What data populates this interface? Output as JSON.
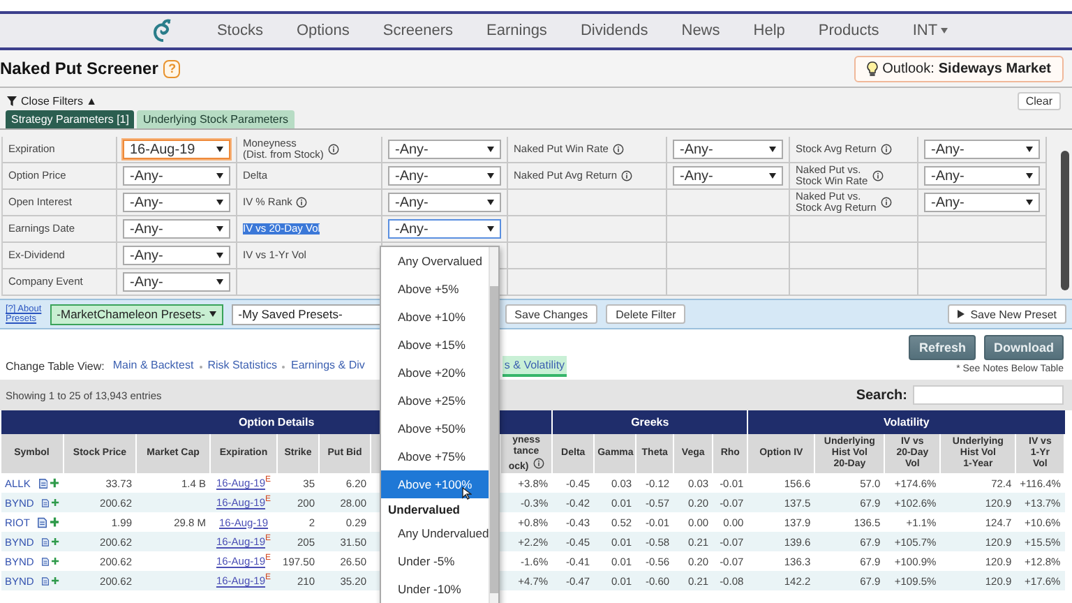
{
  "nav": {
    "items": [
      {
        "label": "Stocks",
        "kind": "link"
      },
      {
        "label": "Options",
        "kind": "link"
      },
      {
        "label": "Screeners",
        "kind": "link"
      },
      {
        "label": "Earnings",
        "kind": "link"
      },
      {
        "label": "Dividends",
        "kind": "link"
      },
      {
        "label": "News",
        "kind": "link"
      },
      {
        "label": "Help",
        "kind": "link"
      },
      {
        "label": "Products",
        "kind": "link"
      },
      {
        "label": "INT",
        "kind": "menu"
      }
    ]
  },
  "title": "Naked Put Screener",
  "help_badge": "?",
  "outlook": {
    "label": "Outlook:",
    "value": "Sideways Market"
  },
  "filters": {
    "toggle": "Close Filters ▲",
    "clear": "Clear",
    "tabs": [
      {
        "label": "Strategy Parameters [1]",
        "selected": true
      },
      {
        "label": "Underlying Stock Parameters",
        "selected": false
      }
    ],
    "rows": [
      {
        "cells": [
          {
            "kind": "label",
            "text": "Expiration",
            "info": false,
            "highlighted": false
          },
          {
            "kind": "select",
            "value": "16-Aug-19",
            "active": true,
            "focused": false
          },
          {
            "kind": "label",
            "text": "Moneyness\n(Dist. from Stock)",
            "info": true,
            "highlighted": false
          },
          {
            "kind": "select",
            "value": "-Any-",
            "active": false,
            "focused": false
          },
          {
            "kind": "label",
            "text": "Naked Put Win Rate",
            "info": true,
            "highlighted": false
          },
          {
            "kind": "select",
            "value": "-Any-",
            "active": false,
            "focused": false
          },
          {
            "kind": "label",
            "text": "Stock Avg Return",
            "info": true,
            "highlighted": false
          },
          {
            "kind": "select",
            "value": "-Any-",
            "active": false,
            "focused": false
          }
        ]
      },
      {
        "cells": [
          {
            "kind": "label",
            "text": "Option Price",
            "info": false,
            "highlighted": false
          },
          {
            "kind": "select",
            "value": "-Any-",
            "active": false,
            "focused": false
          },
          {
            "kind": "label",
            "text": "Delta",
            "info": false,
            "highlighted": false
          },
          {
            "kind": "select",
            "value": "-Any-",
            "active": false,
            "focused": false
          },
          {
            "kind": "label",
            "text": "Naked Put Avg Return",
            "info": true,
            "highlighted": false
          },
          {
            "kind": "select",
            "value": "-Any-",
            "active": false,
            "focused": false
          },
          {
            "kind": "label",
            "text": "Naked Put vs.\nStock Win Rate",
            "info": true,
            "highlighted": false
          },
          {
            "kind": "select",
            "value": "-Any-",
            "active": false,
            "focused": false
          }
        ]
      },
      {
        "cells": [
          {
            "kind": "label",
            "text": "Open Interest",
            "info": false,
            "highlighted": false
          },
          {
            "kind": "select",
            "value": "-Any-",
            "active": false,
            "focused": false
          },
          {
            "kind": "label",
            "text": "IV % Rank",
            "info": true,
            "highlighted": false
          },
          {
            "kind": "select",
            "value": "-Any-",
            "active": false,
            "focused": false
          },
          {
            "kind": "empty"
          },
          {
            "kind": "empty"
          },
          {
            "kind": "label",
            "text": "Naked Put vs.\nStock Avg Return",
            "info": true,
            "highlighted": false
          },
          {
            "kind": "select",
            "value": "-Any-",
            "active": false,
            "focused": false
          }
        ]
      },
      {
        "cells": [
          {
            "kind": "label",
            "text": "Earnings Date",
            "info": false,
            "highlighted": false
          },
          {
            "kind": "select",
            "value": "-Any-",
            "active": false,
            "focused": false
          },
          {
            "kind": "label",
            "text": "IV vs 20-Day Vol",
            "info": false,
            "highlighted": true
          },
          {
            "kind": "select",
            "value": "-Any-",
            "active": false,
            "focused": true
          },
          {
            "kind": "empty"
          },
          {
            "kind": "empty"
          },
          {
            "kind": "empty"
          },
          {
            "kind": "empty"
          }
        ]
      },
      {
        "cells": [
          {
            "kind": "label",
            "text": "Ex-Dividend",
            "info": false,
            "highlighted": false
          },
          {
            "kind": "select",
            "value": "-Any-",
            "active": false,
            "focused": false
          },
          {
            "kind": "label",
            "text": "IV vs 1-Yr Vol",
            "info": false,
            "highlighted": false
          },
          {
            "kind": "empty"
          },
          {
            "kind": "empty"
          },
          {
            "kind": "empty"
          },
          {
            "kind": "empty"
          },
          {
            "kind": "empty"
          }
        ]
      },
      {
        "cells": [
          {
            "kind": "label",
            "text": "Company Event",
            "info": false,
            "highlighted": false
          },
          {
            "kind": "select",
            "value": "-Any-",
            "active": false,
            "focused": false
          },
          {
            "kind": "empty"
          },
          {
            "kind": "empty"
          },
          {
            "kind": "empty"
          },
          {
            "kind": "empty"
          },
          {
            "kind": "empty"
          },
          {
            "kind": "empty"
          }
        ]
      }
    ]
  },
  "presets": {
    "about": "[?] About\nPresets",
    "chameleon": "-MarketChameleon Presets-",
    "saved": "-My Saved Presets-",
    "save_changes": "Save Changes",
    "delete": "Delete Filter",
    "save_new": "Save New Preset"
  },
  "views": {
    "label": "Change Table View:",
    "items": [
      {
        "label": "Main & Backtest",
        "selected": false
      },
      {
        "label": "Risk Statistics",
        "selected": false
      },
      {
        "label": "Earnings & Div",
        "selected": false
      },
      {
        "label": "s & Volatility",
        "selected": true
      }
    ]
  },
  "actions": {
    "refresh": "Refresh",
    "download": "Download",
    "note": "* See Notes Below Table"
  },
  "showing": "Showing 1 to 25 of 13,943 entries",
  "search_label": "Search:",
  "table": {
    "groups": [
      {
        "label": "Option Details",
        "columns": [
          {
            "label": "Symbol",
            "kind": "symbol",
            "info": false
          },
          {
            "label": "Stock Price",
            "kind": "number",
            "info": false
          },
          {
            "label": "Market Cap",
            "kind": "number",
            "info": false
          },
          {
            "label": "Expiration",
            "kind": "date",
            "info": false
          },
          {
            "label": "Strike",
            "kind": "number",
            "info": false
          },
          {
            "label": "Put Bid",
            "kind": "number",
            "info": false
          },
          {
            "label": "yness\ntance\nock)",
            "kind": "number",
            "info": true
          }
        ]
      },
      {
        "label": "Greeks",
        "columns": [
          {
            "label": "Delta",
            "kind": "number",
            "info": false
          },
          {
            "label": "Gamma",
            "kind": "number",
            "info": false
          },
          {
            "label": "Theta",
            "kind": "number",
            "info": false
          },
          {
            "label": "Vega",
            "kind": "number",
            "info": false
          },
          {
            "label": "Rho",
            "kind": "number",
            "info": false
          }
        ]
      },
      {
        "label": "Volatility",
        "columns": [
          {
            "label": "Option IV",
            "kind": "number",
            "info": false
          },
          {
            "label": "Underlying\nHist Vol\n20-Day",
            "kind": "number",
            "info": false
          },
          {
            "label": "IV vs\n20-Day\nVol",
            "kind": "number",
            "info": false
          },
          {
            "label": "Underlying\nHist Vol\n1-Year",
            "kind": "number",
            "info": false
          },
          {
            "label": "IV vs\n1-Yr\nVol",
            "kind": "number",
            "info": false
          }
        ]
      }
    ],
    "rows": [
      {
        "cells": [
          "ALLK",
          "33.73",
          "1.4 B",
          "16-Aug-19",
          "35",
          "6.20",
          "+3.8%",
          "-0.45",
          "0.03",
          "-0.12",
          "0.03",
          "-0.01",
          "156.6",
          "57.0",
          "+174.6%",
          "72.4",
          "+116.4%"
        ],
        "exp_mark": "E"
      },
      {
        "cells": [
          "BYND",
          "200.62",
          null,
          "16-Aug-19",
          "200",
          "28.00",
          "-0.3%",
          "-0.42",
          "0.01",
          "-0.57",
          "0.20",
          "-0.07",
          "137.5",
          "67.9",
          "+102.6%",
          "120.9",
          "+13.7%"
        ],
        "exp_mark": "E"
      },
      {
        "cells": [
          "RIOT",
          "1.99",
          "29.8 M",
          "16-Aug-19",
          "2",
          "0.29",
          "+0.8%",
          "-0.43",
          "0.52",
          "-0.01",
          "0.00",
          "0.00",
          "137.9",
          "136.5",
          "+1.1%",
          "124.7",
          "+10.6%"
        ]
      },
      {
        "cells": [
          "BYND",
          "200.62",
          null,
          "16-Aug-19",
          "205",
          "31.50",
          "+2.2%",
          "-0.45",
          "0.01",
          "-0.58",
          "0.21",
          "-0.07",
          "139.6",
          "67.9",
          "+105.7%",
          "120.9",
          "+15.5%"
        ],
        "exp_mark": "E"
      },
      {
        "cells": [
          "BYND",
          "200.62",
          null,
          "16-Aug-19",
          "197.50",
          "26.50",
          "-1.6%",
          "-0.41",
          "0.01",
          "-0.56",
          "0.20",
          "-0.07",
          "136.3",
          "67.9",
          "+100.9%",
          "120.9",
          "+12.8%"
        ],
        "exp_mark": "E"
      },
      {
        "cells": [
          "BYND",
          "200.62",
          null,
          "16-Aug-19",
          "210",
          "35.20",
          "+4.7%",
          "-0.47",
          "0.01",
          "-0.60",
          "0.21",
          "-0.08",
          "142.2",
          "67.9",
          "+109.5%",
          "120.9",
          "+17.6%"
        ],
        "exp_mark": "E"
      }
    ]
  },
  "dropdown": {
    "items": [
      {
        "kind": "option",
        "label": "Any Overvalued",
        "selected": false
      },
      {
        "kind": "option",
        "label": "Above +5%",
        "selected": false
      },
      {
        "kind": "option",
        "label": "Above +10%",
        "selected": false
      },
      {
        "kind": "option",
        "label": "Above +15%",
        "selected": false
      },
      {
        "kind": "option",
        "label": "Above +20%",
        "selected": false
      },
      {
        "kind": "option",
        "label": "Above +25%",
        "selected": false
      },
      {
        "kind": "option",
        "label": "Above +50%",
        "selected": false
      },
      {
        "kind": "option",
        "label": "Above +75%",
        "selected": false
      },
      {
        "kind": "option",
        "label": "Above +100%",
        "selected": true
      },
      {
        "kind": "group",
        "label": "Undervalued"
      },
      {
        "kind": "option",
        "label": "Any Undervalued",
        "selected": false
      },
      {
        "kind": "option",
        "label": "Under -5%",
        "selected": false
      },
      {
        "kind": "option",
        "label": "Under -10%",
        "selected": false
      }
    ]
  }
}
